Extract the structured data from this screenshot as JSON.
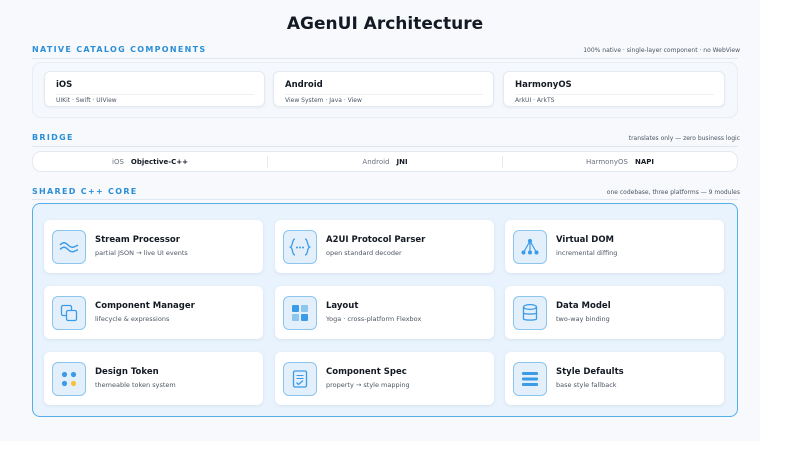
{
  "title": "AGenUI Architecture",
  "native": {
    "label": "NATIVE CATALOG COMPONENTS",
    "note": "100% native · single-layer component · no WebView",
    "platforms": [
      {
        "name": "iOS",
        "desc": "UIKit · Swift · UIView"
      },
      {
        "name": "Android",
        "desc": "View System · Java · View"
      },
      {
        "name": "HarmonyOS",
        "desc": "ArkUI · ArkTS"
      }
    ]
  },
  "bridge": {
    "label": "BRIDGE",
    "note": "translates only — zero business logic",
    "items": [
      {
        "platform": "iOS",
        "lang": "Objective-C++"
      },
      {
        "platform": "Android",
        "lang": "JNI"
      },
      {
        "platform": "HarmonyOS",
        "lang": "NAPI"
      }
    ]
  },
  "core": {
    "label": "SHARED C++ CORE",
    "note": "one codebase, three platforms — 9 modules",
    "modules": [
      {
        "name": "Stream Processor",
        "desc": "partial JSON → live UI events",
        "icon": "wave-icon"
      },
      {
        "name": "A2UI Protocol Parser",
        "desc": "open standard decoder",
        "icon": "braces-icon"
      },
      {
        "name": "Virtual DOM",
        "desc": "incremental diffing",
        "icon": "tree-icon"
      },
      {
        "name": "Component Manager",
        "desc": "lifecycle & expressions",
        "icon": "layers-icon"
      },
      {
        "name": "Layout",
        "desc": "Yoga · cross-platform Flexbox",
        "icon": "grid-icon"
      },
      {
        "name": "Data Model",
        "desc": "two-way binding",
        "icon": "database-icon"
      },
      {
        "name": "Design Token",
        "desc": "themeable token system",
        "icon": "palette-icon"
      },
      {
        "name": "Component Spec",
        "desc": "property → style mapping",
        "icon": "spec-icon"
      },
      {
        "name": "Style Defaults",
        "desc": "base style fallback",
        "icon": "list-icon"
      }
    ]
  },
  "colors": {
    "accent": "#2b8fd6",
    "core_border": "#56aee9",
    "core_bg": "#e9f3fd",
    "icon_bg": "#e3f0fc",
    "token_blue": "#3b9be6",
    "token_yellow": "#f5c33b"
  }
}
